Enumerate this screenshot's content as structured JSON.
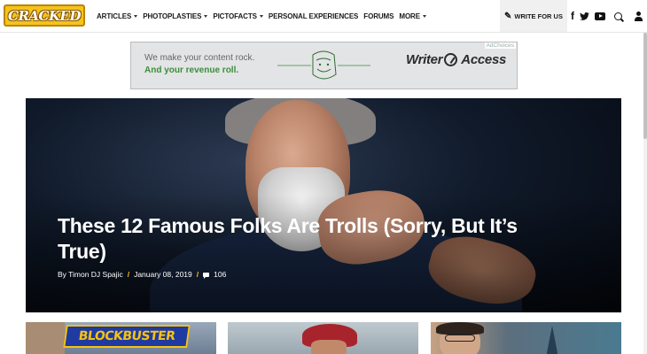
{
  "header": {
    "logo": "CRACKED",
    "nav": [
      {
        "label": "ARTICLES",
        "has_caret": true
      },
      {
        "label": "PHOTOPLASTIES",
        "has_caret": true
      },
      {
        "label": "PICTOFACTS",
        "has_caret": true
      },
      {
        "label": "PERSONAL EXPERIENCES",
        "has_caret": false
      },
      {
        "label": "FORUMS",
        "has_caret": false
      },
      {
        "label": "MORE",
        "has_caret": true
      }
    ],
    "write_for_us": "WRITE FOR US",
    "social_icons": [
      "facebook-icon",
      "twitter-icon",
      "youtube-icon",
      "search-icon",
      "user-icon"
    ]
  },
  "ad": {
    "line1": "We make your content rock.",
    "line2": "And your revenue roll.",
    "brand_left": "Writer",
    "brand_right": "Access",
    "choices": "AdChoices"
  },
  "hero": {
    "title": "These 12 Famous Folks Are Trolls (Sorry, But It’s True)",
    "author": "By Timon DJ Spajic",
    "date": "January 08, 2019",
    "comments": "106"
  },
  "thumbnails": [
    {
      "sign_text": "BLOCKBUSTER"
    },
    {},
    {}
  ],
  "colors": {
    "brand_yellow": "#f7c31b",
    "ad_green": "#3c8d3c",
    "hero_bg": "#0c1522"
  }
}
